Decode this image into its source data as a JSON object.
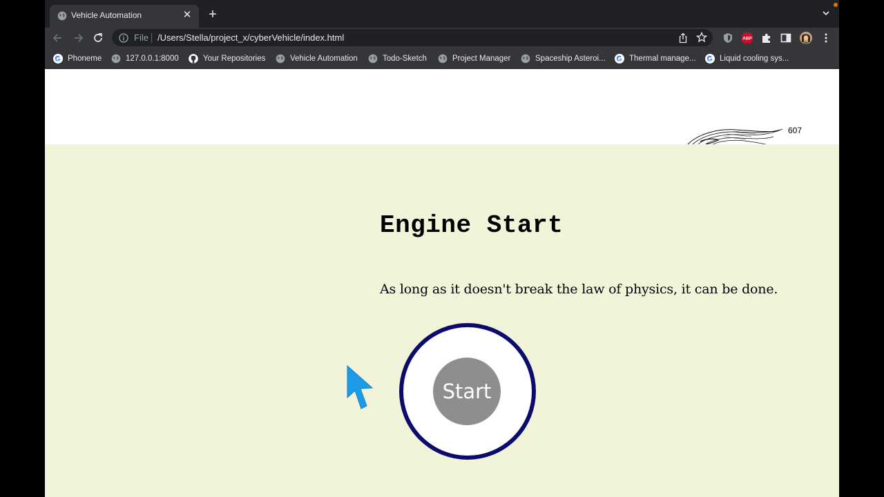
{
  "tab": {
    "title": "Vehicle Automation",
    "close_glyph": "✕",
    "new_tab_glyph": "+"
  },
  "omnibox": {
    "scheme_label": "File",
    "url": "/Users/Stella/project_x/cyberVehicle/index.html"
  },
  "extensions": {
    "abp_label": "ABP"
  },
  "bookmarks": [
    {
      "label": "Phoneme",
      "icon": "google-icon"
    },
    {
      "label": "127.0.0.1:8000",
      "icon": "globe-icon"
    },
    {
      "label": "Your Repositories",
      "icon": "github-icon"
    },
    {
      "label": "Vehicle Automation",
      "icon": "globe-icon"
    },
    {
      "label": "Todo-Sketch",
      "icon": "globe-icon"
    },
    {
      "label": "Project Manager",
      "icon": "globe-icon"
    },
    {
      "label": "Spaceship Asteroi...",
      "icon": "globe-icon"
    },
    {
      "label": "Thermal manage...",
      "icon": "google-icon"
    },
    {
      "label": "Liquid cooling sys...",
      "icon": "google-icon"
    }
  ],
  "page": {
    "sketch_label": "607",
    "heading": "Engine Start",
    "quote": "As long as it doesn't break the law of physics, it can be done.",
    "start_label": "Start"
  },
  "colors": {
    "page_background": "#f2f4da",
    "ring": "#0b0b6e",
    "start_button": "#8e8e8e",
    "cursor": "#1e9be8"
  }
}
